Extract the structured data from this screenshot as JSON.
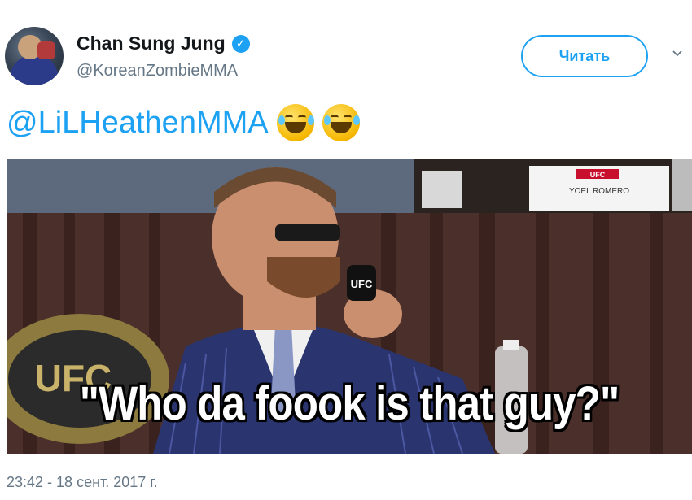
{
  "user": {
    "display_name": "Chan Sung Jung",
    "handle": "@KoreanZombieMMA",
    "verified_icon": "verified-badge-icon"
  },
  "actions": {
    "follow_label": "Читать",
    "menu_icon": "chevron-down-icon"
  },
  "tweet": {
    "mention": "@LiLHeathenMMA",
    "emojis": [
      "rolling-on-floor-laughing-emoji",
      "rolling-on-floor-laughing-emoji"
    ]
  },
  "media": {
    "caption": "\"Who da foook is that guy?\"",
    "nameplate_logo": "UFC",
    "nameplate_name": "YOEL ROMERO",
    "mic_logo": "UFC",
    "belt_logo": "UFC"
  },
  "meta": {
    "timestamp": "23:42 - 18 сент. 2017 г."
  },
  "colors": {
    "accent": "#1da1f2",
    "text": "#14171a",
    "secondary": "#657786"
  }
}
